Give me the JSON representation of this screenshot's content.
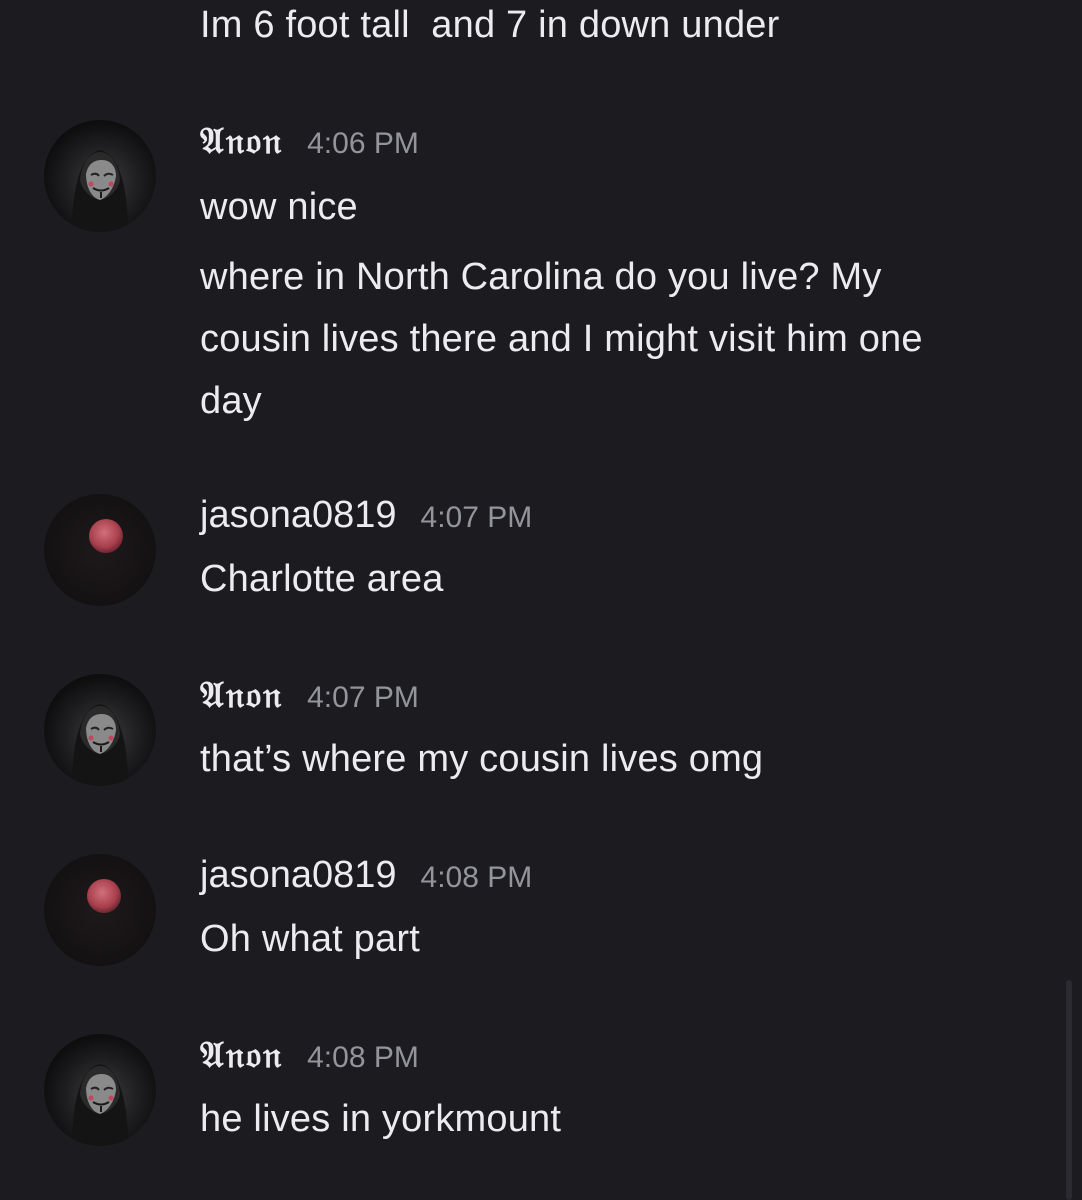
{
  "partial_message": {
    "text": "Im 6 foot tall  and 7 in down under"
  },
  "messages": [
    {
      "author": "𝔄𝔫𝔬𝔫",
      "avatar": "anonymous-mask-avatar",
      "time": "4:06 PM",
      "lines": [
        "wow nice",
        "where in North Carolina do you live? My",
        "cousin lives there and I might visit him one",
        "day"
      ]
    },
    {
      "author": "jasona0819",
      "avatar": "blood-moon-avatar",
      "time": "4:07 PM",
      "lines": [
        "Charlotte area"
      ]
    },
    {
      "author": "𝔄𝔫𝔬𝔫",
      "avatar": "anonymous-mask-avatar",
      "time": "4:07 PM",
      "lines": [
        "that’s where my cousin lives omg"
      ]
    },
    {
      "author": "jasona0819",
      "avatar": "blood-moon-avatar",
      "time": "4:08 PM",
      "lines": [
        "Oh what part"
      ]
    },
    {
      "author": "𝔄𝔫𝔬𝔫",
      "avatar": "anonymous-mask-avatar",
      "time": "4:08 PM",
      "lines": [
        "he lives in yorkmount"
      ]
    }
  ],
  "colors": {
    "background": "#1b1b20",
    "text": "#ececef",
    "timestamp": "#94959c",
    "moon": "#b5505c"
  }
}
